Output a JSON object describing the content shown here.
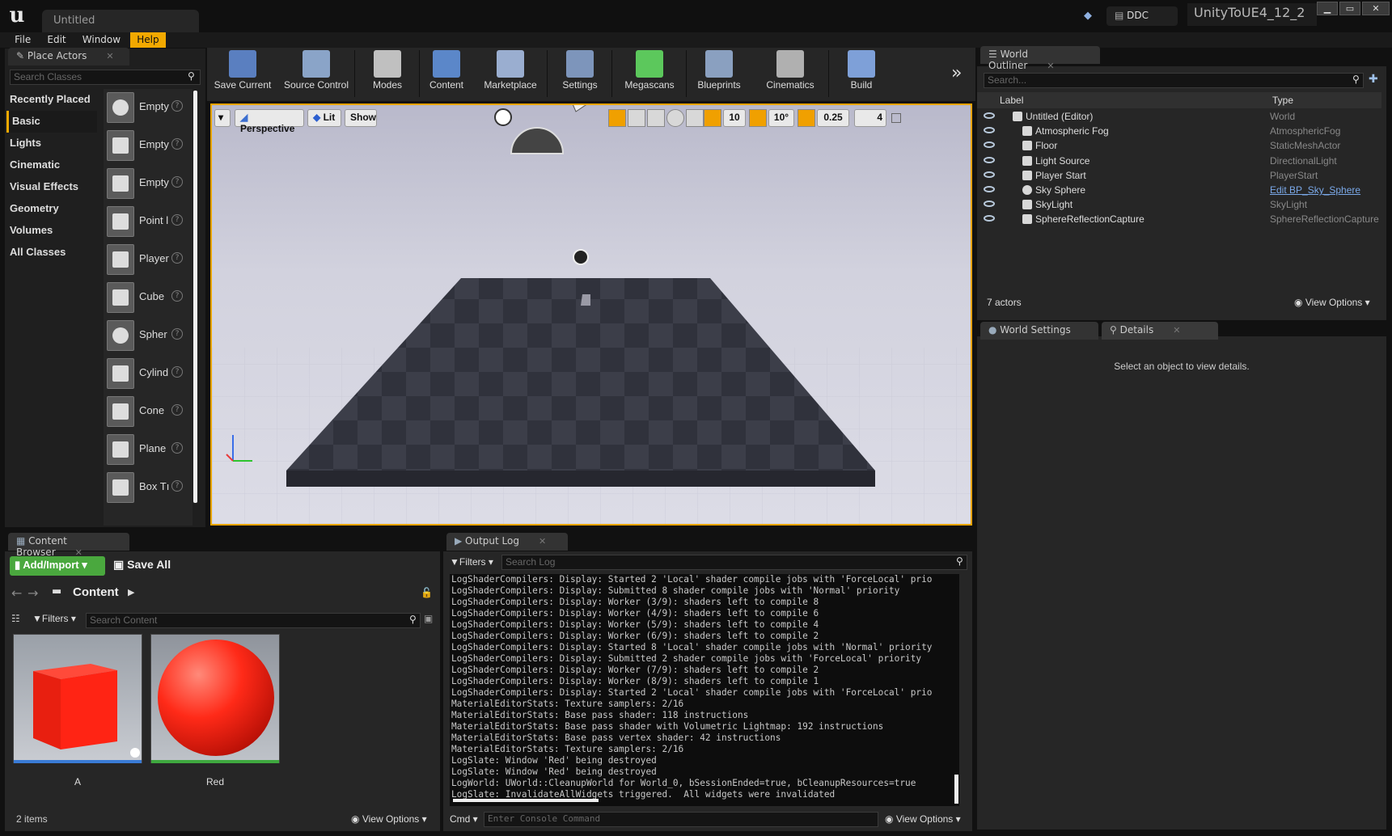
{
  "title_bar": {
    "document_tab": "Untitled",
    "ddc_label": "DDC",
    "project_name": "UnityToUE4_12_2",
    "window_buttons": [
      "minimize",
      "maximize",
      "close"
    ]
  },
  "menu": [
    "File",
    "Edit",
    "Window",
    "Help"
  ],
  "menu_active": "Help",
  "place_actors": {
    "tab_title": "Place Actors",
    "search_placeholder": "Search Classes",
    "categories": [
      "Recently Placed",
      "Basic",
      "Lights",
      "Cinematic",
      "Visual Effects",
      "Geometry",
      "Volumes",
      "All Classes"
    ],
    "selected_category": "Basic",
    "items": [
      {
        "label": "Empty",
        "icon": "sphere-icon"
      },
      {
        "label": "Empty",
        "icon": "character-icon"
      },
      {
        "label": "Empty",
        "icon": "pawn-icon"
      },
      {
        "label": "Point l",
        "icon": "point-light-icon"
      },
      {
        "label": "Player",
        "icon": "player-start-icon"
      },
      {
        "label": "Cube",
        "icon": "cube-icon"
      },
      {
        "label": "Spher",
        "icon": "sphere-icon"
      },
      {
        "label": "Cylind",
        "icon": "cylinder-icon"
      },
      {
        "label": "Cone",
        "icon": "cone-icon"
      },
      {
        "label": "Plane",
        "icon": "plane-icon"
      },
      {
        "label": "Box Tı",
        "icon": "box-trigger-icon"
      }
    ]
  },
  "toolbar": [
    {
      "label": "Save Current",
      "icon": "save-icon",
      "color": "#5a7fc0"
    },
    {
      "label": "Source Control",
      "icon": "source-control-icon",
      "color": "#8aa4c8"
    },
    {
      "label": "Modes",
      "icon": "modes-icon",
      "color": "#c0c0c0"
    },
    {
      "label": "Content",
      "icon": "content-icon",
      "color": "#5b87c9"
    },
    {
      "label": "Marketplace",
      "icon": "marketplace-icon",
      "color": "#9aaed0"
    },
    {
      "label": "Settings",
      "icon": "settings-icon",
      "color": "#7d95bb"
    },
    {
      "label": "Megascans",
      "icon": "megascans-icon",
      "color": "#5cc85c"
    },
    {
      "label": "Blueprints",
      "icon": "blueprints-icon",
      "color": "#8aa0c0"
    },
    {
      "label": "Cinematics",
      "icon": "cinematics-icon",
      "color": "#b0b0b0"
    },
    {
      "label": "Build",
      "icon": "build-icon",
      "color": "#7ea0d8"
    }
  ],
  "viewport": {
    "perspective": "Perspective",
    "lit": "Lit",
    "show": "Show",
    "grid_snap": "10",
    "rotation_snap": "10°",
    "scale_snap": "0.25",
    "camera_speed": "4"
  },
  "outliner": {
    "tab_title": "World Outliner",
    "search_placeholder": "Search...",
    "col_label": "Label",
    "col_type": "Type",
    "rows": [
      {
        "label": "Untitled (Editor)",
        "type": "World",
        "icon": "world-icon"
      },
      {
        "label": "Atmospheric Fog",
        "type": "AtmosphericFog",
        "icon": "fog-icon"
      },
      {
        "label": "Floor",
        "type": "StaticMeshActor",
        "icon": "static-mesh-icon"
      },
      {
        "label": "Light Source",
        "type": "DirectionalLight",
        "icon": "directional-light-icon"
      },
      {
        "label": "Player Start",
        "type": "PlayerStart",
        "icon": "player-start-icon"
      },
      {
        "label": "Sky Sphere",
        "type": "Edit BP_Sky_Sphere",
        "icon": "sphere-icon"
      },
      {
        "label": "SkyLight",
        "type": "SkyLight",
        "icon": "skylight-icon"
      },
      {
        "label": "SphereReflectionCapture",
        "type": "SphereReflectionCapture",
        "icon": "reflection-capture-icon"
      }
    ],
    "count": "7 actors",
    "view_options": "View Options"
  },
  "details": {
    "tab_world_settings": "World Settings",
    "tab_details": "Details",
    "empty_text": "Select an object to view details."
  },
  "content_browser": {
    "tab_title": "Content Browser",
    "add_import": "Add/Import",
    "save_all": "Save All",
    "path": "Content",
    "filters": "Filters",
    "search_placeholder": "Search Content",
    "assets": [
      {
        "name": "A",
        "kind": "cube",
        "bar_color": "#3a7bd5"
      },
      {
        "name": "Red",
        "kind": "sphere",
        "bar_color": "#3fa83f"
      }
    ],
    "count": "2 items",
    "view_options": "View Options"
  },
  "output_log": {
    "tab_title": "Output Log",
    "filters": "Filters",
    "search_placeholder": "Search Log",
    "lines": [
      "LogShaderCompilers: Display: Started 2 'Local' shader compile jobs with 'ForceLocal' prio",
      "LogShaderCompilers: Display: Submitted 8 shader compile jobs with 'Normal' priority",
      "LogShaderCompilers: Display: Worker (3/9): shaders left to compile 8",
      "LogShaderCompilers: Display: Worker (4/9): shaders left to compile 6",
      "LogShaderCompilers: Display: Worker (5/9): shaders left to compile 4",
      "LogShaderCompilers: Display: Worker (6/9): shaders left to compile 2",
      "LogShaderCompilers: Display: Started 8 'Local' shader compile jobs with 'Normal' priority",
      "LogShaderCompilers: Display: Submitted 2 shader compile jobs with 'ForceLocal' priority",
      "LogShaderCompilers: Display: Worker (7/9): shaders left to compile 2",
      "LogShaderCompilers: Display: Worker (8/9): shaders left to compile 1",
      "LogShaderCompilers: Display: Started 2 'Local' shader compile jobs with 'ForceLocal' prio",
      "MaterialEditorStats: Texture samplers: 2/16",
      "MaterialEditorStats: Base pass shader: 118 instructions",
      "MaterialEditorStats: Base pass shader with Volumetric Lightmap: 192 instructions",
      "MaterialEditorStats: Base pass vertex shader: 42 instructions",
      "MaterialEditorStats: Texture samplers: 2/16",
      "LogSlate: Window 'Red' being destroyed",
      "LogSlate: Window 'Red' being destroyed",
      "LogWorld: UWorld::CleanupWorld for World_0, bSessionEnded=true, bCleanupResources=true",
      "LogSlate: InvalidateAllWidgets triggered.  All widgets were invalidated"
    ],
    "cmd_label": "Cmd",
    "console_placeholder": "Enter Console Command",
    "view_options": "View Options"
  }
}
